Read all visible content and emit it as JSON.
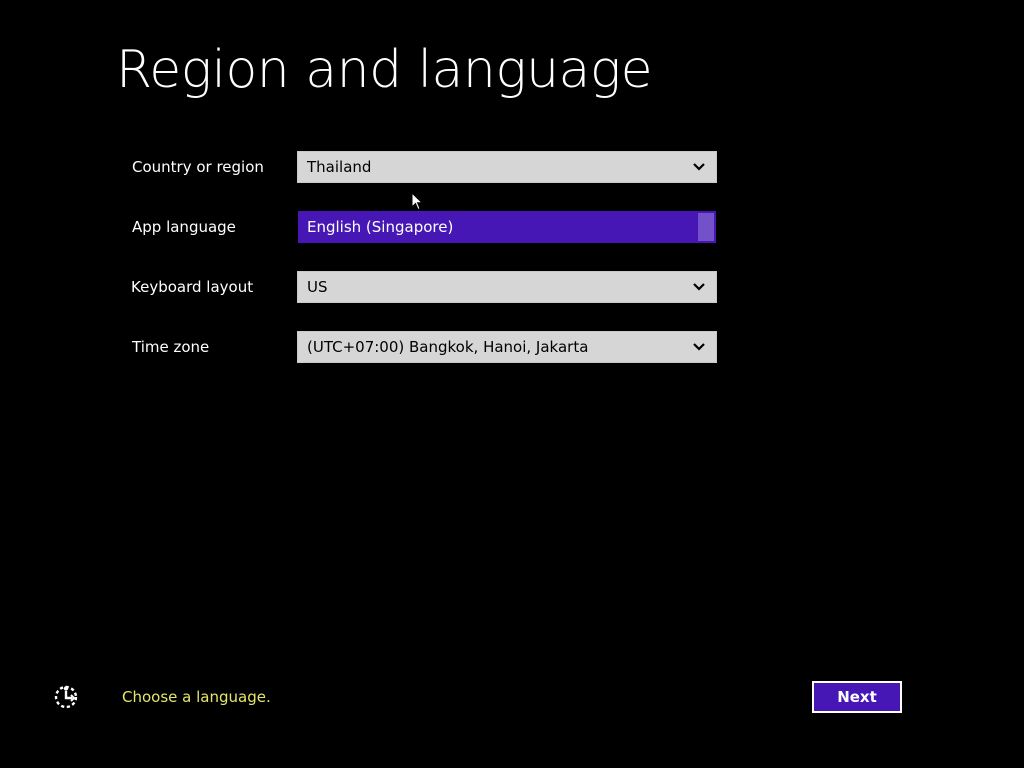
{
  "page": {
    "title": "Region and language"
  },
  "form": {
    "country": {
      "label": "Country or region",
      "value": "Thailand"
    },
    "app_language": {
      "label": "App language",
      "value": "English (Singapore)"
    },
    "keyboard": {
      "label": "Keyboard layout",
      "value": "US"
    },
    "timezone": {
      "label": "Time zone",
      "value": "(UTC+07:00) Bangkok, Hanoi, Jakarta"
    }
  },
  "footer": {
    "hint": "Choose a language.",
    "next_label": "Next",
    "ease_of_access_icon": "ease-of-access-icon"
  },
  "colors": {
    "background": "#000000",
    "accent": "#4617b4",
    "field_bg": "#d6d6d6",
    "hint_text": "#e5e66a"
  }
}
